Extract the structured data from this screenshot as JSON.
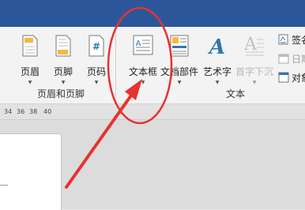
{
  "ribbon": {
    "header_footer_group": {
      "label": "页眉和页脚",
      "buttons": [
        {
          "label": "页眉",
          "icon": "header-icon"
        },
        {
          "label": "页脚",
          "icon": "footer-icon"
        },
        {
          "label": "页码",
          "icon": "page-number-icon"
        }
      ]
    },
    "text_group": {
      "label": "文本",
      "buttons": [
        {
          "label": "文本框",
          "icon": "textbox-icon"
        },
        {
          "label": "文档部件",
          "icon": "quick-parts-icon"
        },
        {
          "label": "艺术字",
          "icon": "wordart-icon"
        },
        {
          "label": "首字下沉",
          "icon": "drop-cap-icon",
          "state": "disabled"
        }
      ],
      "small_items": [
        {
          "label": "签名",
          "icon": "signature-line-icon"
        },
        {
          "label": "日期",
          "icon": "date-time-icon",
          "state": "disabled"
        },
        {
          "label": "对象",
          "icon": "object-icon"
        }
      ]
    }
  },
  "ruler": {
    "ticks": [
      "34",
      "36",
      "38",
      "40"
    ]
  },
  "colors": {
    "accent": "#2b579a",
    "annotation": "#e8322f",
    "wordart": "#2e74b5"
  }
}
